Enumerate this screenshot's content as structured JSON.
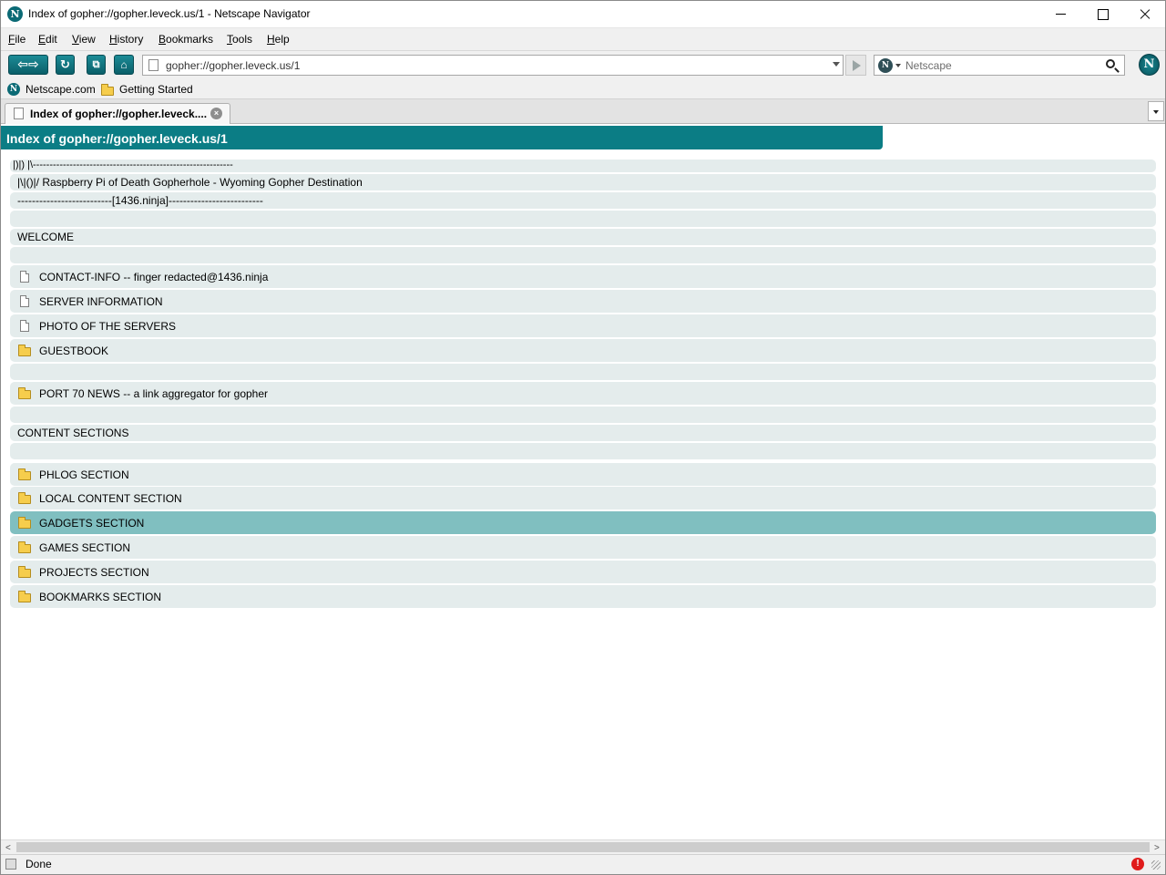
{
  "window": {
    "title": "Index of gopher://gopher.leveck.us/1 - Netscape Navigator",
    "app_icon_glyph": "N"
  },
  "menu": [
    {
      "label": "File",
      "accel": "F",
      "rest": "ile"
    },
    {
      "label": "Edit",
      "accel": "E",
      "rest": "dit"
    },
    {
      "label": "View",
      "accel": "V",
      "rest": "iew"
    },
    {
      "label": "History",
      "accel": "H",
      "rest": "istory"
    },
    {
      "label": "Bookmarks",
      "accel": "B",
      "rest": "ookmarks"
    },
    {
      "label": "Tools",
      "accel": "T",
      "rest": "ools"
    },
    {
      "label": "Help",
      "accel": "H",
      "rest": "elp"
    }
  ],
  "toolbar": {
    "back_glyph": "⇦⇨",
    "reload_glyph": "↻",
    "newtab_glyph": "⧉",
    "home_glyph": "⌂",
    "url": "gopher://gopher.leveck.us/1",
    "search_placeholder": "Netscape",
    "search_engine_glyph": "N",
    "throbber_glyph": "N"
  },
  "bookmarks": [
    {
      "label": "Netscape.com",
      "icon": "netscape-icon"
    },
    {
      "label": "Getting Started",
      "icon": "folder-icon"
    }
  ],
  "tab": {
    "label": "Index of gopher://gopher.leveck....",
    "close_glyph": "×"
  },
  "page": {
    "header": "Index of gopher://gopher.leveck.us/1",
    "rows": [
      {
        "type": "info",
        "text": "|)|) |\\------------------------------------------------------------"
      },
      {
        "type": "info",
        "text": "|\\|()|/ Raspberry Pi of Death Gopherhole - Wyoming Gopher Destination"
      },
      {
        "type": "info",
        "text": "--------------------------[1436.ninja]--------------------------"
      },
      {
        "type": "info",
        "text": ""
      },
      {
        "type": "info",
        "text": "WELCOME"
      },
      {
        "type": "info",
        "text": ""
      },
      {
        "type": "doc",
        "text": "CONTACT-INFO -- finger redacted@1436.ninja"
      },
      {
        "type": "doc",
        "text": "SERVER INFORMATION"
      },
      {
        "type": "doc",
        "text": "PHOTO OF THE SERVERS"
      },
      {
        "type": "dir",
        "text": "GUESTBOOK"
      },
      {
        "type": "info",
        "text": ""
      },
      {
        "type": "dir",
        "text": "PORT 70 NEWS -- a link aggregator for gopher"
      },
      {
        "type": "info",
        "text": ""
      },
      {
        "type": "info",
        "text": "CONTENT SECTIONS"
      },
      {
        "type": "info",
        "text": ""
      },
      {
        "type": "dir",
        "text": "PHLOG SECTION"
      },
      {
        "type": "dir",
        "text": "LOCAL CONTENT SECTION"
      },
      {
        "type": "dir",
        "text": "GADGETS SECTION",
        "selected": true
      },
      {
        "type": "dir",
        "text": "GAMES SECTION"
      },
      {
        "type": "dir",
        "text": "PROJECTS SECTION"
      },
      {
        "type": "dir",
        "text": "BOOKMARKS SECTION"
      }
    ]
  },
  "status": {
    "text": "Done",
    "alert_glyph": "!"
  },
  "colors": {
    "accent": "#0b7d85",
    "row_bg": "#e4ecec",
    "row_selected": "#80bfc0"
  }
}
